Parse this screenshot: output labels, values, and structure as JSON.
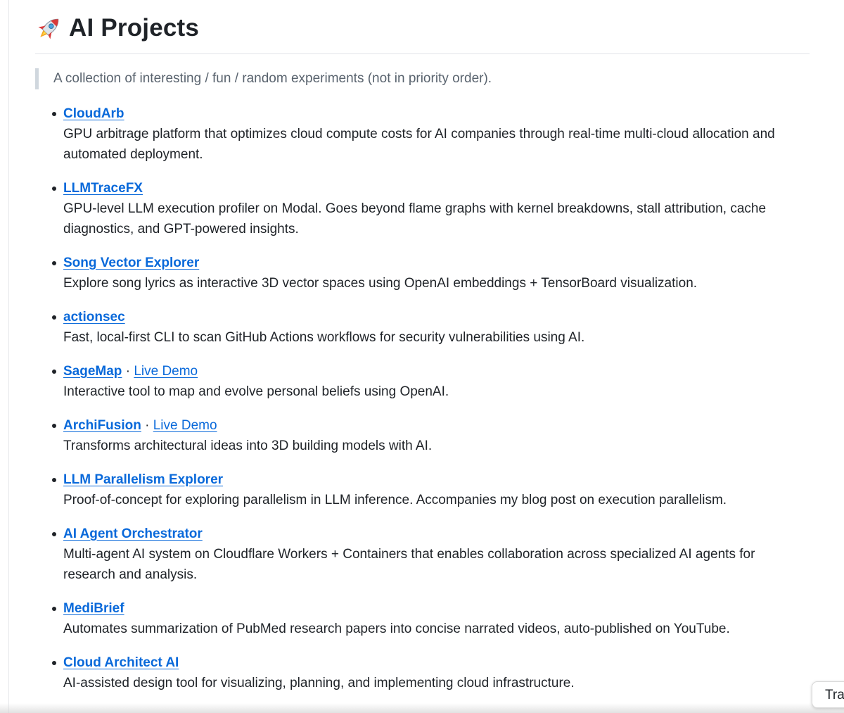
{
  "header": {
    "icon": "rocket-icon",
    "title": "AI Projects"
  },
  "intro": "A collection of interesting / fun / random experiments (not in priority order).",
  "projects": [
    {
      "name": "CloudArb",
      "description": "GPU arbitrage platform that optimizes cloud compute costs for AI companies through real-time multi-cloud allocation and automated deployment."
    },
    {
      "name": "LLMTraceFX",
      "description": "GPU-level LLM execution profiler on Modal. Goes beyond flame graphs with kernel breakdowns, stall attribution, cache diagnostics, and GPT-powered insights."
    },
    {
      "name": "Song Vector Explorer",
      "description": "Explore song lyrics as interactive 3D vector spaces using OpenAI embeddings + TensorBoard visualization."
    },
    {
      "name": "actionsec",
      "description": "Fast, local-first CLI to scan GitHub Actions workflows for security vulnerabilities using AI."
    },
    {
      "name": "SageMap",
      "separator": "·",
      "demo": "Live Demo",
      "description": "Interactive tool to map and evolve personal beliefs using OpenAI."
    },
    {
      "name": "ArchiFusion",
      "separator": "·",
      "demo": "Live Demo",
      "description": "Transforms architectural ideas into 3D building models with AI."
    },
    {
      "name": "LLM Parallelism Explorer",
      "description": "Proof-of-concept for exploring parallelism in LLM inference. Accompanies my blog post on execution parallelism."
    },
    {
      "name": "AI Agent Orchestrator",
      "description": "Multi-agent AI system on Cloudflare Workers + Containers that enables collaboration across specialized AI agents for research and analysis."
    },
    {
      "name": "MediBrief",
      "description": "Automates summarization of PubMed research papers into concise narrated videos, auto-published on YouTube."
    },
    {
      "name": "Cloud Architect AI",
      "description": "AI-assisted design tool for visualizing, planning, and implementing cloud infrastructure."
    }
  ],
  "translate_button": {
    "label": "Tra"
  },
  "colors": {
    "link": "#0969da",
    "text": "#1f2328",
    "muted": "#59636e"
  }
}
